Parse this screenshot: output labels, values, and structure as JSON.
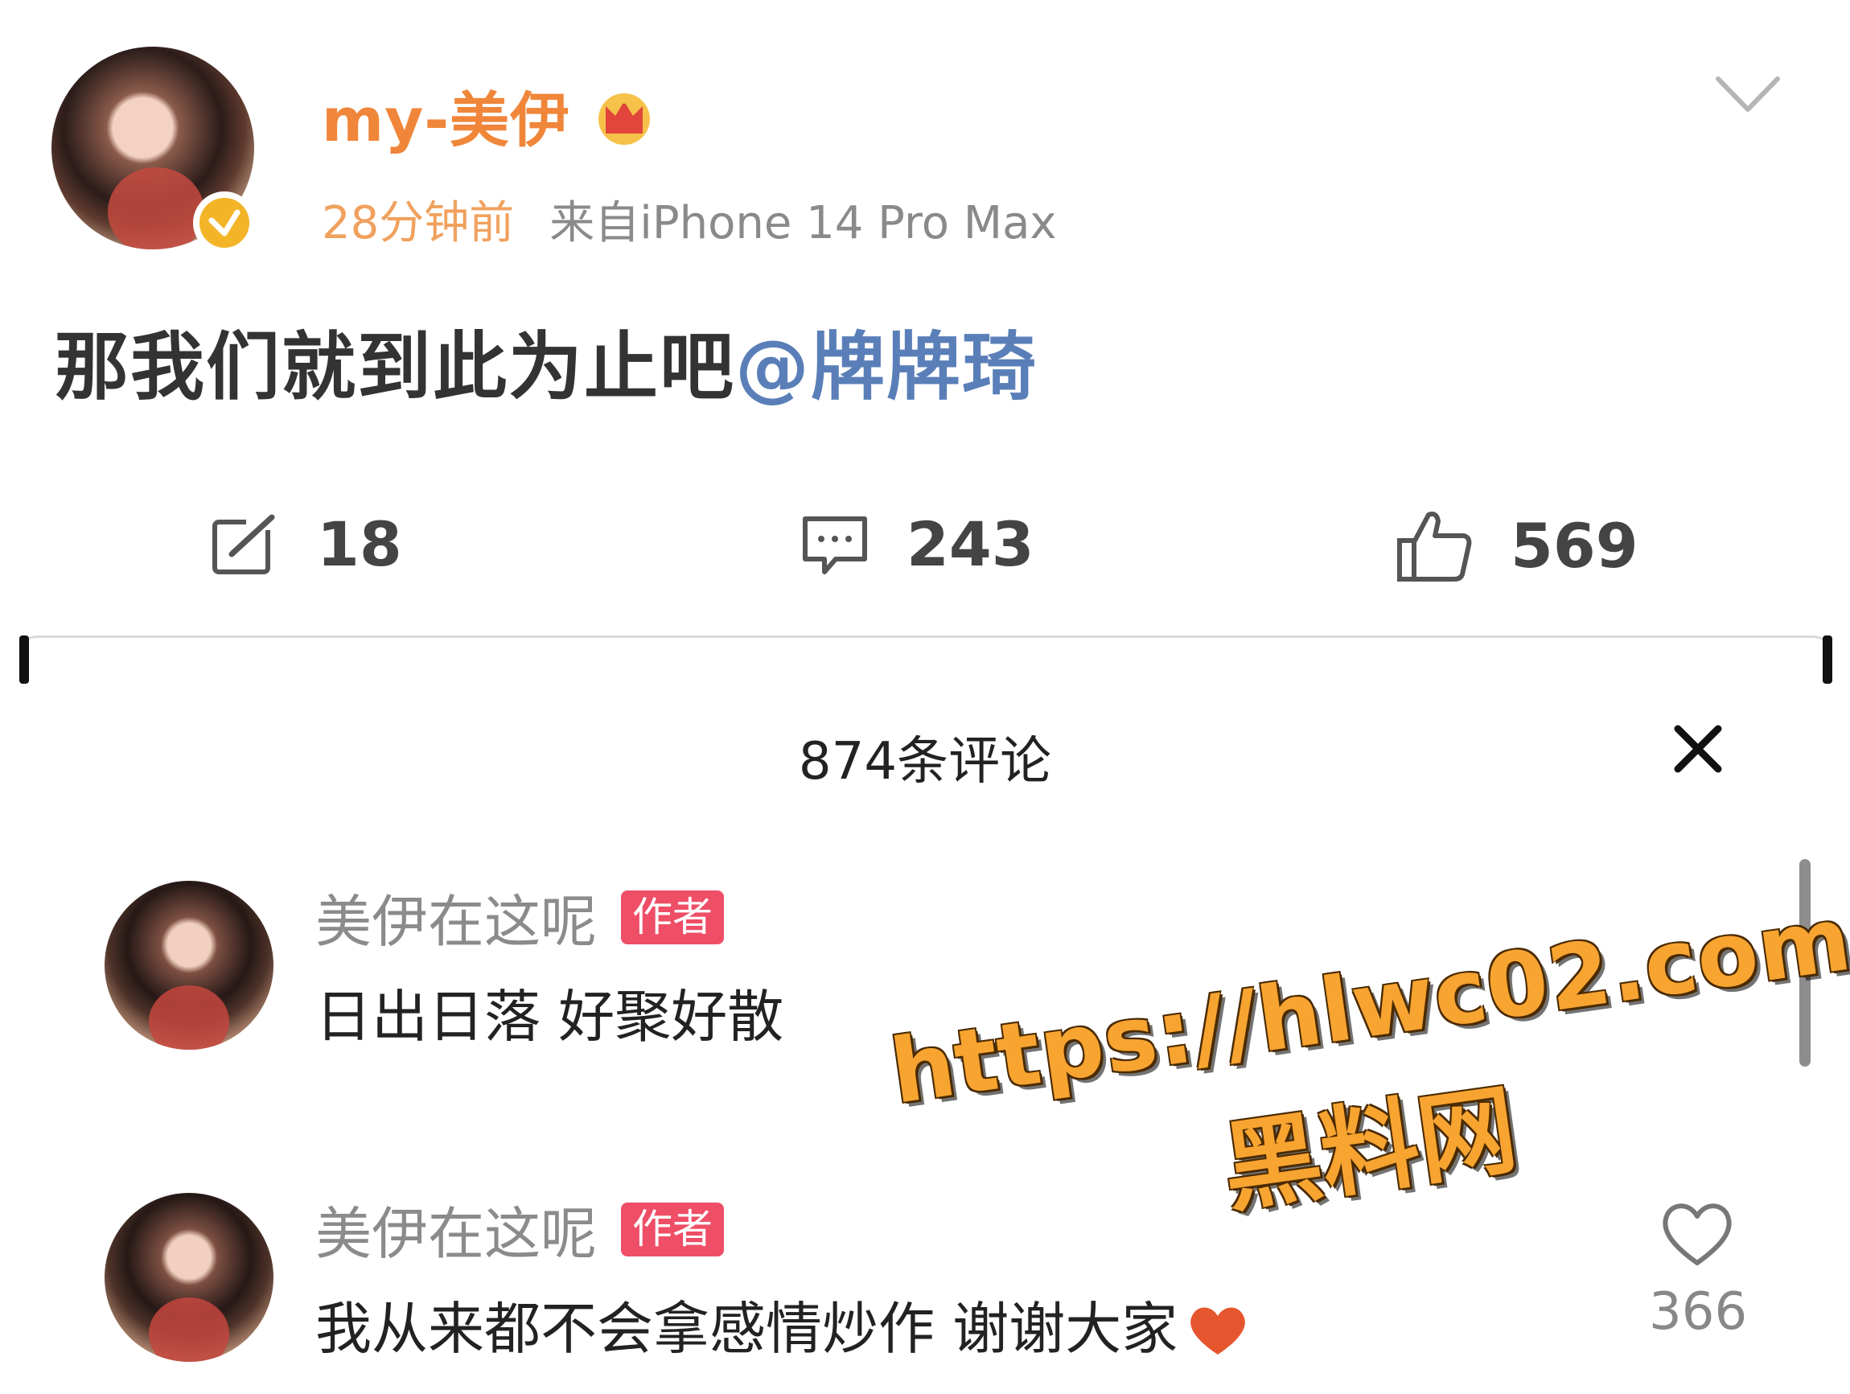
{
  "post": {
    "username": "my-美伊",
    "time": "28分钟前",
    "source": "来自iPhone 14 Pro Max",
    "text": "那我们就到此为止吧",
    "mention": "@牌牌琦"
  },
  "actions": {
    "repost_count": "18",
    "comment_count": "243",
    "like_count": "569"
  },
  "comments_sheet": {
    "title": "874条评论",
    "comments": [
      {
        "author": "美伊在这呢",
        "badge": "作者",
        "text": "日出日落 好聚好散"
      },
      {
        "author": "美伊在这呢",
        "badge": "作者",
        "text": "我从来都不会拿感情炒作 谢谢大家",
        "likes": "366"
      }
    ]
  },
  "watermark": {
    "url": "https://hlwc02.com",
    "site": "黑料网"
  },
  "colors": {
    "username": "#f0863a",
    "mention": "#5a7fb8",
    "author_badge": "#ef4e67",
    "verified": "#f3b428",
    "watermark": "#f7a431"
  },
  "icons": [
    "chevron-down-icon",
    "crown-icon",
    "verified-icon",
    "repost-icon",
    "comment-icon",
    "thumbs-up-icon",
    "close-icon",
    "heart-icon",
    "heart-outline-icon"
  ]
}
